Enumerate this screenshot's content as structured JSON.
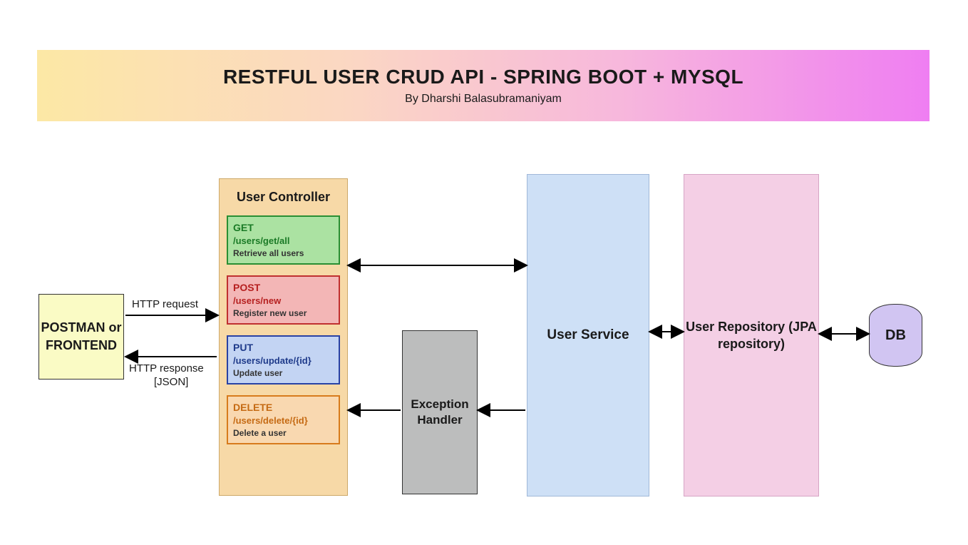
{
  "banner": {
    "title": "RESTFUL USER CRUD API - SPRING BOOT + MYSQL",
    "author": "By Dharshi Balasubramaniyam"
  },
  "postman": "POSTMAN or FRONTEND",
  "controller": {
    "title": "User Controller",
    "endpoints": [
      {
        "id": "get",
        "method": "GET",
        "path": "/users/get/all",
        "desc": "Retrieve all users"
      },
      {
        "id": "post",
        "method": "POST",
        "path": "/users/new",
        "desc": "Register new user"
      },
      {
        "id": "put",
        "method": "PUT",
        "path": "/users/update/{id}",
        "desc": "Update user"
      },
      {
        "id": "delete",
        "method": "DELETE",
        "path": "/users/delete/{id}",
        "desc": "Delete a user"
      }
    ]
  },
  "exception": "Exception Handler",
  "service": "User Service",
  "repository": "User Repository (JPA repository)",
  "db": "DB",
  "labels": {
    "httpRequest": "HTTP request",
    "httpResponse1": "HTTP response",
    "httpResponse2": "[JSON]"
  }
}
